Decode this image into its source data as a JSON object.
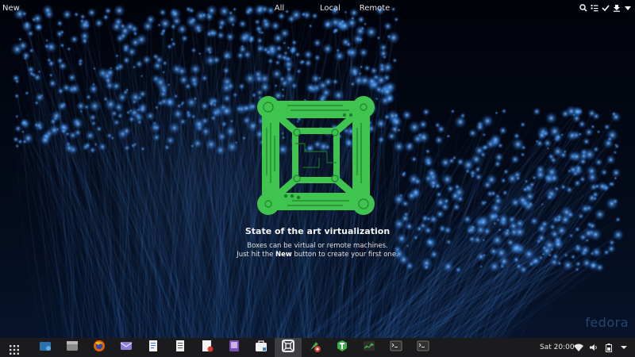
{
  "header": {
    "new_label": "New",
    "tabs": [
      {
        "label": "All"
      },
      {
        "label": "Local"
      },
      {
        "label": "Remote"
      }
    ],
    "icons": [
      "search-icon",
      "select-list-icon",
      "check-icon",
      "download-icon",
      "menu-icon"
    ]
  },
  "empty_state": {
    "title": "State of the art virtualization",
    "line1": "Boxes can be virtual or remote machines.",
    "line2_prefix": "Just hit the ",
    "line2_bold": "New",
    "line2_suffix": " button to create your first one.",
    "logo_color": "#3fc44f"
  },
  "watermark": "fedora",
  "taskbar": {
    "apps": [
      {
        "name": "screenshot-app-icon"
      },
      {
        "name": "files-icon"
      },
      {
        "name": "firefox-icon"
      },
      {
        "name": "mail-icon"
      },
      {
        "name": "document-viewer-icon"
      },
      {
        "name": "text-editor-icon"
      },
      {
        "name": "document-edit-icon"
      },
      {
        "name": "image-viewer-icon"
      },
      {
        "name": "software-center-icon"
      },
      {
        "name": "boxes-icon"
      },
      {
        "name": "tools-app-icon"
      },
      {
        "name": "wrench-app-icon"
      },
      {
        "name": "system-monitor-icon"
      },
      {
        "name": "terminal-icon"
      },
      {
        "name": "terminal-icon-2"
      }
    ],
    "active_index": 9,
    "clock": "Sat 20:00",
    "tray": [
      "wifi-icon",
      "volume-icon",
      "battery-icon",
      "system-menu-chevron-icon"
    ]
  },
  "colors": {
    "accent_green": "#3fc44f",
    "taskbar_bg": "#1b1b1e",
    "fiber_blue": "#3a7fd0"
  }
}
